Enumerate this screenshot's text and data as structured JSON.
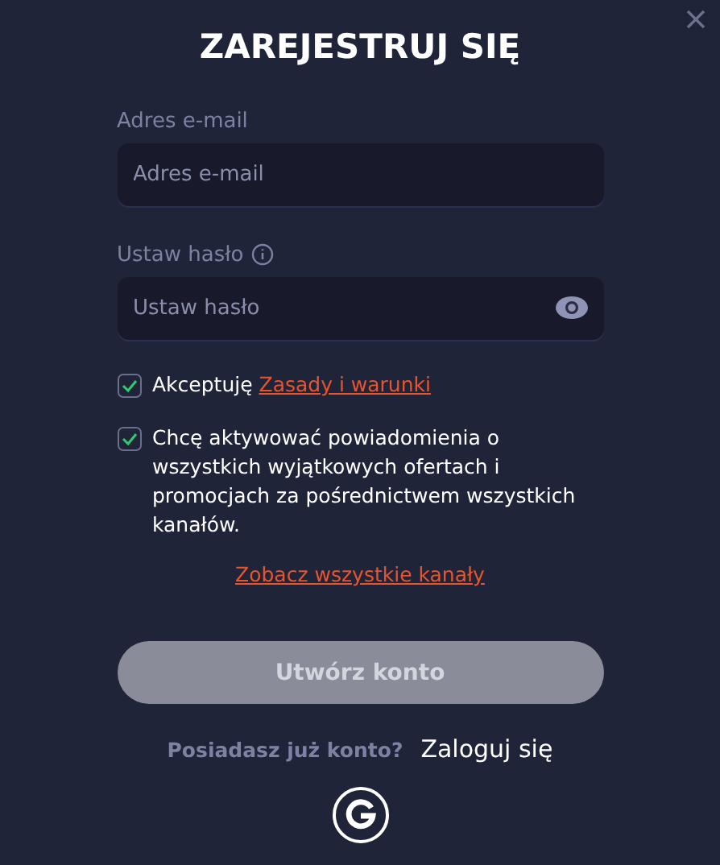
{
  "title": "ZAREJESTRUJ SIĘ",
  "fields": [
    {
      "label": "Adres e-mail",
      "placeholder": "Adres e-mail",
      "kind": "email"
    },
    {
      "label": "Ustaw hasło",
      "placeholder": "Ustaw hasło",
      "kind": "password"
    }
  ],
  "consents": [
    {
      "text": "Akceptuję",
      "link": "Zasady i warunki",
      "checked": true
    },
    {
      "text": "Chcę aktywować powiadomienia o wszystkich wyjątkowych ofertach i promocjach za pośrednictwem wszystkich kanałów.",
      "checked": true
    }
  ],
  "channels_link": "Zobacz wszystkie kanały",
  "submit": {
    "label": "Utwórz konto",
    "disabled": true
  },
  "login_prompt": "Posiadasz już konto?",
  "login_link": "Zaloguj się"
}
